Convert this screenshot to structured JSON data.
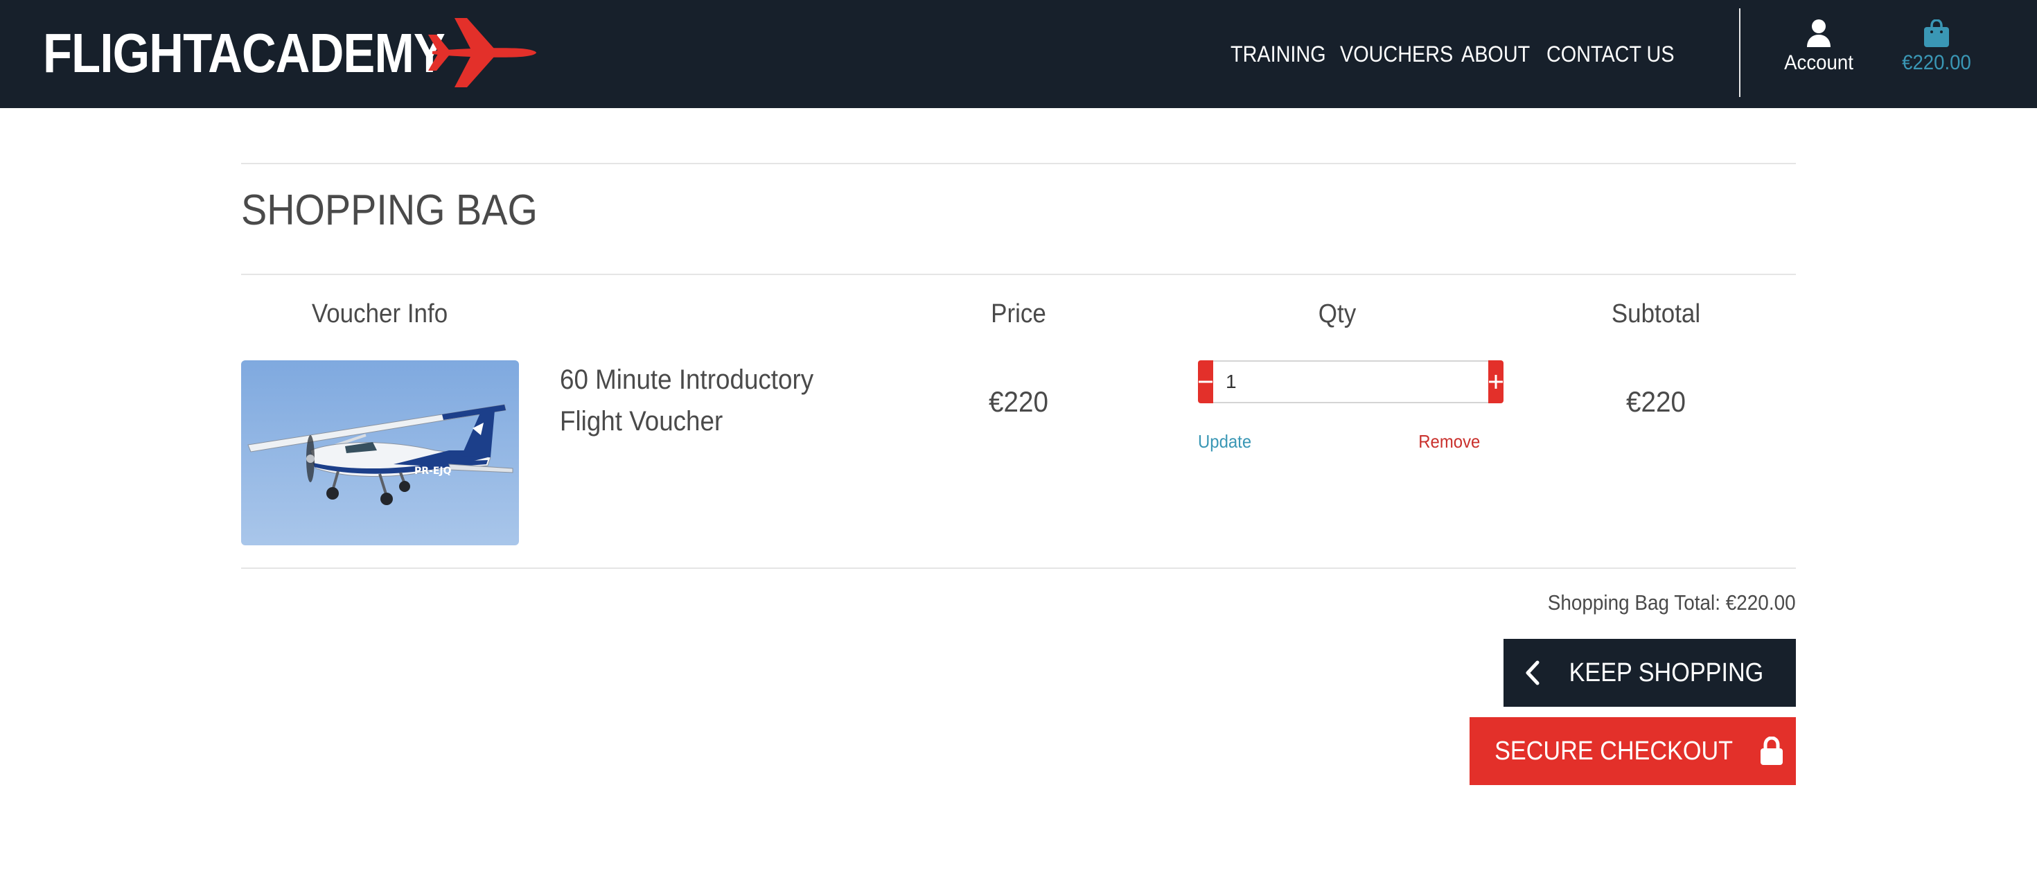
{
  "brand": {
    "name": "FLIGHTACADEMY",
    "logo_icon": "plane-icon",
    "logo_color": "#e3302a"
  },
  "nav": {
    "items": [
      {
        "label": "TRAINING"
      },
      {
        "label": "VOUCHERS"
      },
      {
        "label": "ABOUT"
      },
      {
        "label": "CONTACT US"
      }
    ],
    "account": {
      "label": "Account",
      "icon": "user-icon"
    },
    "bag": {
      "amount": "€220.00",
      "icon": "shopping-bag-icon",
      "color": "#3a97b5"
    }
  },
  "page": {
    "title": "SHOPPING BAG"
  },
  "table": {
    "headers": {
      "voucher_info": "Voucher Info",
      "price": "Price",
      "qty": "Qty",
      "subtotal": "Subtotal"
    },
    "items": [
      {
        "name_line1": "60 Minute Introductory",
        "name_line2": "Flight Voucher",
        "image": "light-aircraft-photo",
        "price": "€220",
        "qty": "1",
        "subtotal": "€220",
        "update_label": "Update",
        "remove_label": "Remove"
      }
    ]
  },
  "summary": {
    "total_text": "Shopping Bag Total: €220.00"
  },
  "actions": {
    "keep_shopping": "KEEP SHOPPING",
    "secure_checkout": "SECURE CHECKOUT"
  },
  "colors": {
    "header_bg": "#17202b",
    "accent_red": "#e3302a",
    "link_blue": "#3a97b5",
    "remove_red": "#c9302c"
  }
}
